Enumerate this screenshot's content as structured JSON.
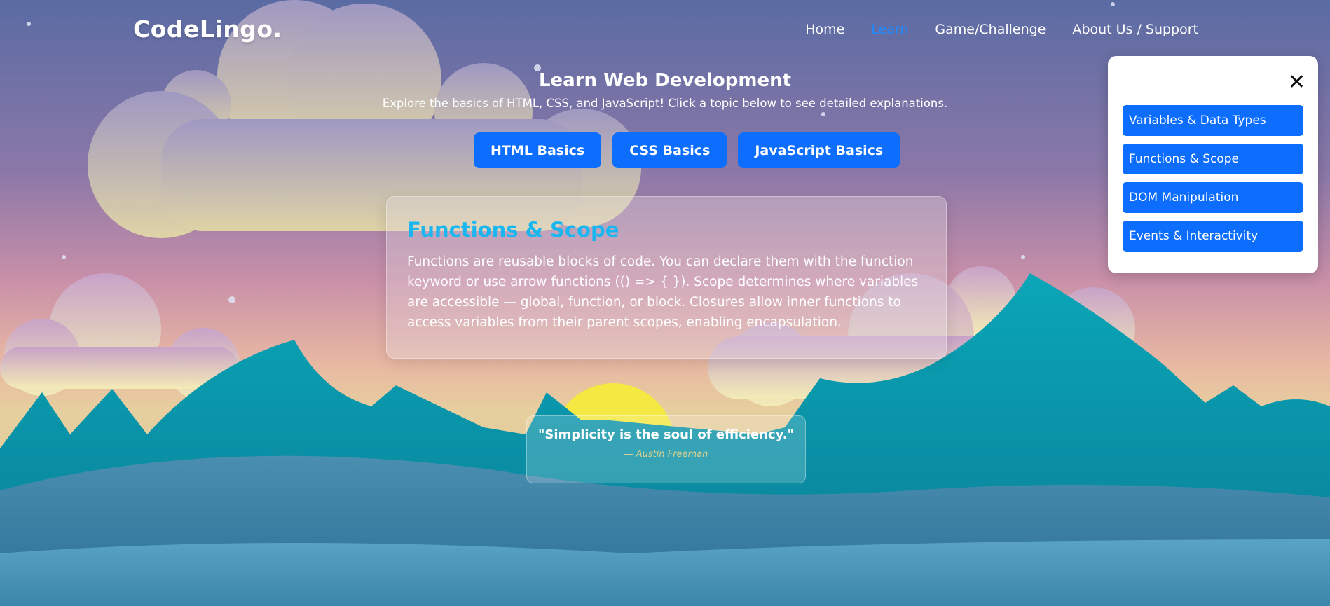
{
  "brand": {
    "logo": "CodeLingo."
  },
  "nav": {
    "items": [
      {
        "label": "Home"
      },
      {
        "label": "Learn"
      },
      {
        "label": "Game/Challenge"
      },
      {
        "label": "About Us / Support"
      }
    ],
    "active_color": "#1f8bff"
  },
  "hero": {
    "title": "Learn Web Development",
    "subtitle": "Explore the basics of HTML, CSS, and JavaScript! Click a topic below to see detailed explanations."
  },
  "topics": [
    {
      "label": "HTML Basics"
    },
    {
      "label": "CSS Basics"
    },
    {
      "label": "JavaScript Basics"
    }
  ],
  "card": {
    "title": "Functions & Scope",
    "body": "Functions are reusable blocks of code. You can declare them with the function keyword or use arrow functions (() => { }). Scope determines where variables are accessible — global, function, or block. Closures allow inner functions to access variables from their parent scopes, enabling encapsulation."
  },
  "quote": {
    "text": "\"Simplicity is the soul of efficiency.\"",
    "author": "— Austin Freeman"
  },
  "side_panel": {
    "close_icon": "close-icon",
    "items": [
      {
        "label": "Variables & Data Types"
      },
      {
        "label": "Functions & Scope"
      },
      {
        "label": "DOM Manipulation"
      },
      {
        "label": "Events & Interactivity"
      }
    ]
  },
  "colors": {
    "primary_button": "#0d6efd",
    "card_title": "#19b6f0",
    "sun": "#f4e842",
    "mountain": "#0f94ad"
  }
}
